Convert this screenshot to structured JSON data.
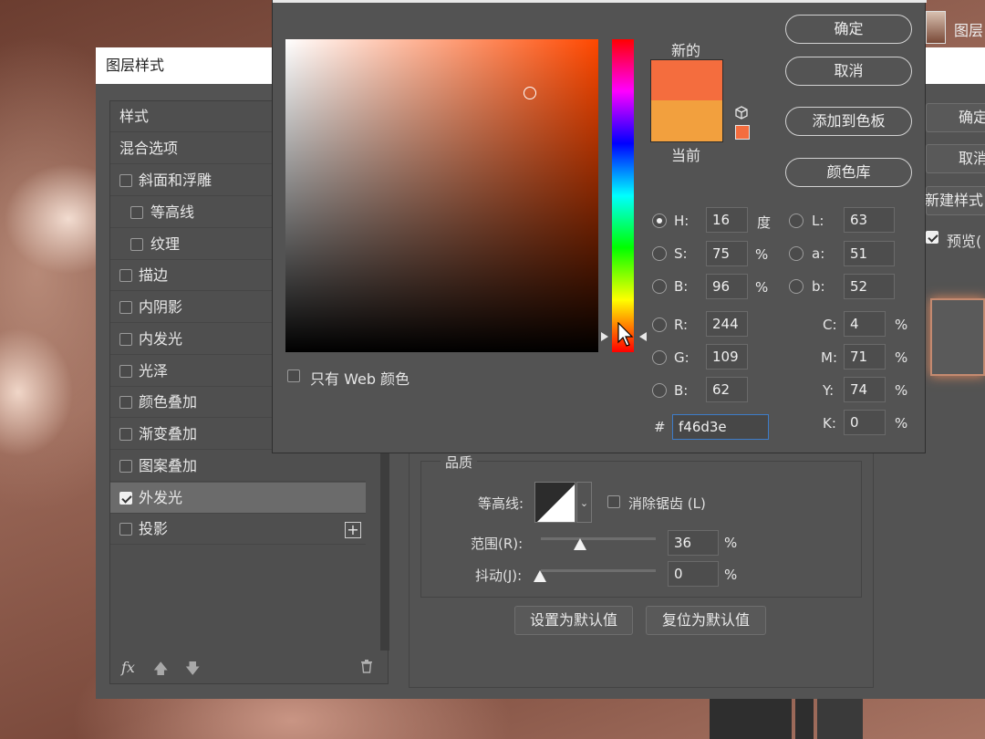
{
  "colors": {
    "new": "#f46d3e",
    "current": "#f2a03e",
    "accent": "#3d7cc9"
  },
  "layer_style": {
    "title": "图层样式",
    "items": [
      "样式",
      "混合选项",
      "斜面和浮雕",
      "等高线",
      "纹理",
      "描边",
      "内阴影",
      "内发光",
      "光泽",
      "颜色叠加",
      "渐变叠加",
      "图案叠加",
      "外发光",
      "投影"
    ],
    "checked_item": "外发光",
    "add_icon": "plus-box-icon",
    "fx_label": "fx",
    "right_buttons": {
      "ok": "确定",
      "cancel": "取消",
      "new_style": "新建样式",
      "preview": "预览("
    },
    "quality": {
      "title": "品质",
      "contour_label": "等高线:",
      "anti_alias_label": "消除锯齿 (L)",
      "range_label": "范围(R):",
      "range_value": "36",
      "range_unit": "%",
      "jitter_label": "抖动(J):",
      "jitter_value": "0",
      "jitter_unit": "%"
    },
    "default_buttons": {
      "set": "设置为默认值",
      "reset": "复位为默认值"
    }
  },
  "top_right_label": "图层",
  "picker": {
    "new_label": "新的",
    "current_label": "当前",
    "buttons": {
      "ok": "确定",
      "cancel": "取消",
      "add_swatch": "添加到色板",
      "libraries": "颜色库"
    },
    "web_only": "只有 Web 颜色",
    "fields": {
      "H": {
        "label": "H:",
        "value": "16",
        "unit": "度"
      },
      "S": {
        "label": "S:",
        "value": "75",
        "unit": "%"
      },
      "Bv": {
        "label": "B:",
        "value": "96",
        "unit": "%"
      },
      "R": {
        "label": "R:",
        "value": "244"
      },
      "G": {
        "label": "G:",
        "value": "109"
      },
      "Bb": {
        "label": "B:",
        "value": "62"
      },
      "L": {
        "label": "L:",
        "value": "63"
      },
      "a": {
        "label": "a:",
        "value": "51"
      },
      "b": {
        "label": "b:",
        "value": "52"
      },
      "C": {
        "label": "C:",
        "value": "4",
        "unit": "%"
      },
      "M": {
        "label": "M:",
        "value": "71",
        "unit": "%"
      },
      "Y": {
        "label": "Y:",
        "value": "74",
        "unit": "%"
      },
      "K": {
        "label": "K:",
        "value": "0",
        "unit": "%"
      }
    },
    "hex_label": "#",
    "hex_value": "f46d3e"
  }
}
